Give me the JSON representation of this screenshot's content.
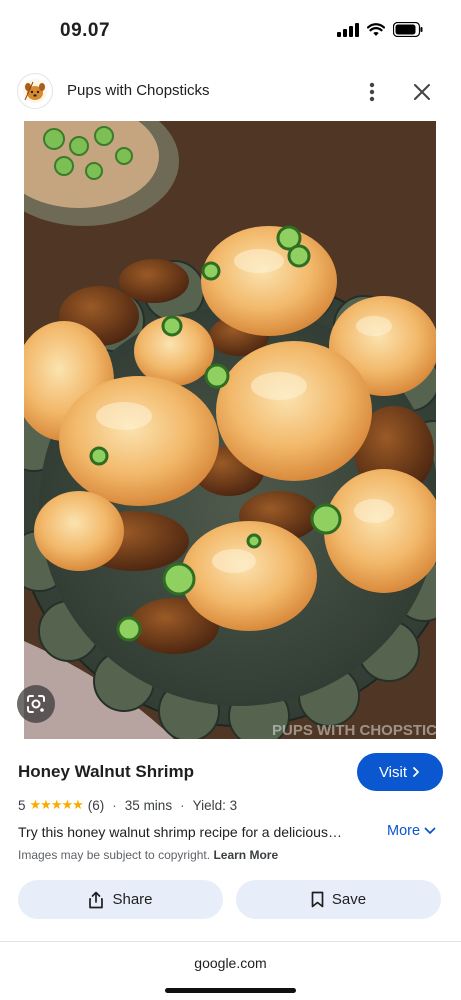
{
  "status_bar": {
    "time": "09.07"
  },
  "header": {
    "site_name": "Pups with Chopsticks",
    "more_icon": "more-vert-icon",
    "close_icon": "close-icon"
  },
  "image": {
    "watermark": "PUPS WITH CHOPSTICKS",
    "alt": "Honey Walnut Shrimp"
  },
  "details": {
    "title": "Honey Walnut Shrimp",
    "visit_label": "Visit",
    "rating": "5",
    "stars": "★★★★★",
    "rating_count": "(6)",
    "time": "35 mins",
    "yield": "Yield: 3",
    "description": "Try this honey walnut shrimp recipe for a delicious…",
    "more_label": "More",
    "copyright_text": "Images may be subject to copyright.",
    "learn_more": "Learn More"
  },
  "actions": {
    "share_label": "Share",
    "save_label": "Save"
  },
  "footer": {
    "domain": "google.com"
  },
  "colors": {
    "accent": "#0b57d0",
    "star": "#f9ab00",
    "button_bg": "#e8eef9"
  }
}
